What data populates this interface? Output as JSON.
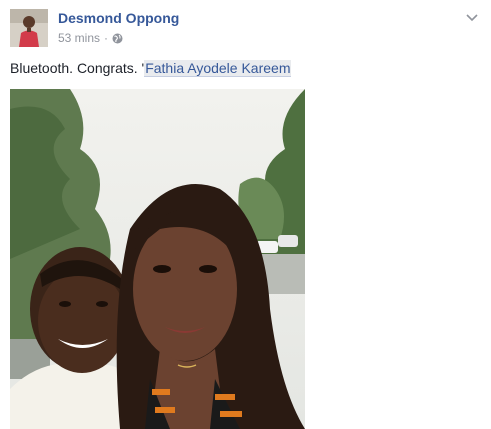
{
  "post": {
    "author_name": "Desmond Oppong",
    "timestamp": "53 mins",
    "separator": "·",
    "privacy_icon": "globe-icon",
    "options_icon": "chevron-down-icon",
    "text_prefix": "Bluetooth. Congrats. '",
    "mention": "Fathia Ayodele Kareem",
    "photo_icon": "selfie-photo"
  },
  "colors": {
    "author_link": "#365899",
    "meta_gray": "#90949c",
    "mention_bg": "#e9ebee",
    "text": "#1d2129"
  }
}
